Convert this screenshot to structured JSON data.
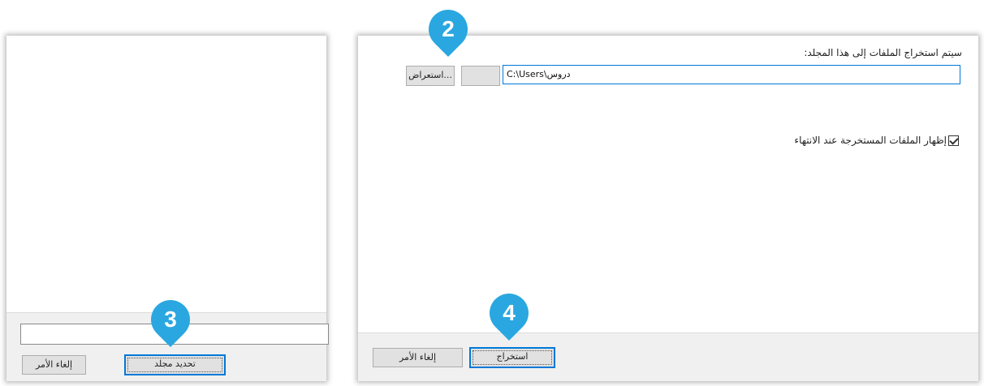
{
  "left_dialog": {
    "folder_name_value": "",
    "select_folder_button": "تحديد مجلد",
    "cancel_button": "إلغاء الأمر"
  },
  "right_dialog": {
    "destination_label": "سيتم استخراج الملفات إلى هذا المجلد:",
    "path_value": "C:\\Users\\دروس",
    "browse_button": "استعراض...",
    "show_files_checkbox_label": "إظهار الملفات المستخرجة عند الانتهاء",
    "show_files_checked": true,
    "extract_button": "استخراج",
    "cancel_button": "إلغاء الأمر"
  },
  "callouts": {
    "browse": "2",
    "select_folder": "3",
    "extract": "4"
  },
  "colors": {
    "callout": "#2aa7e0",
    "focus_border": "#0078d7"
  }
}
